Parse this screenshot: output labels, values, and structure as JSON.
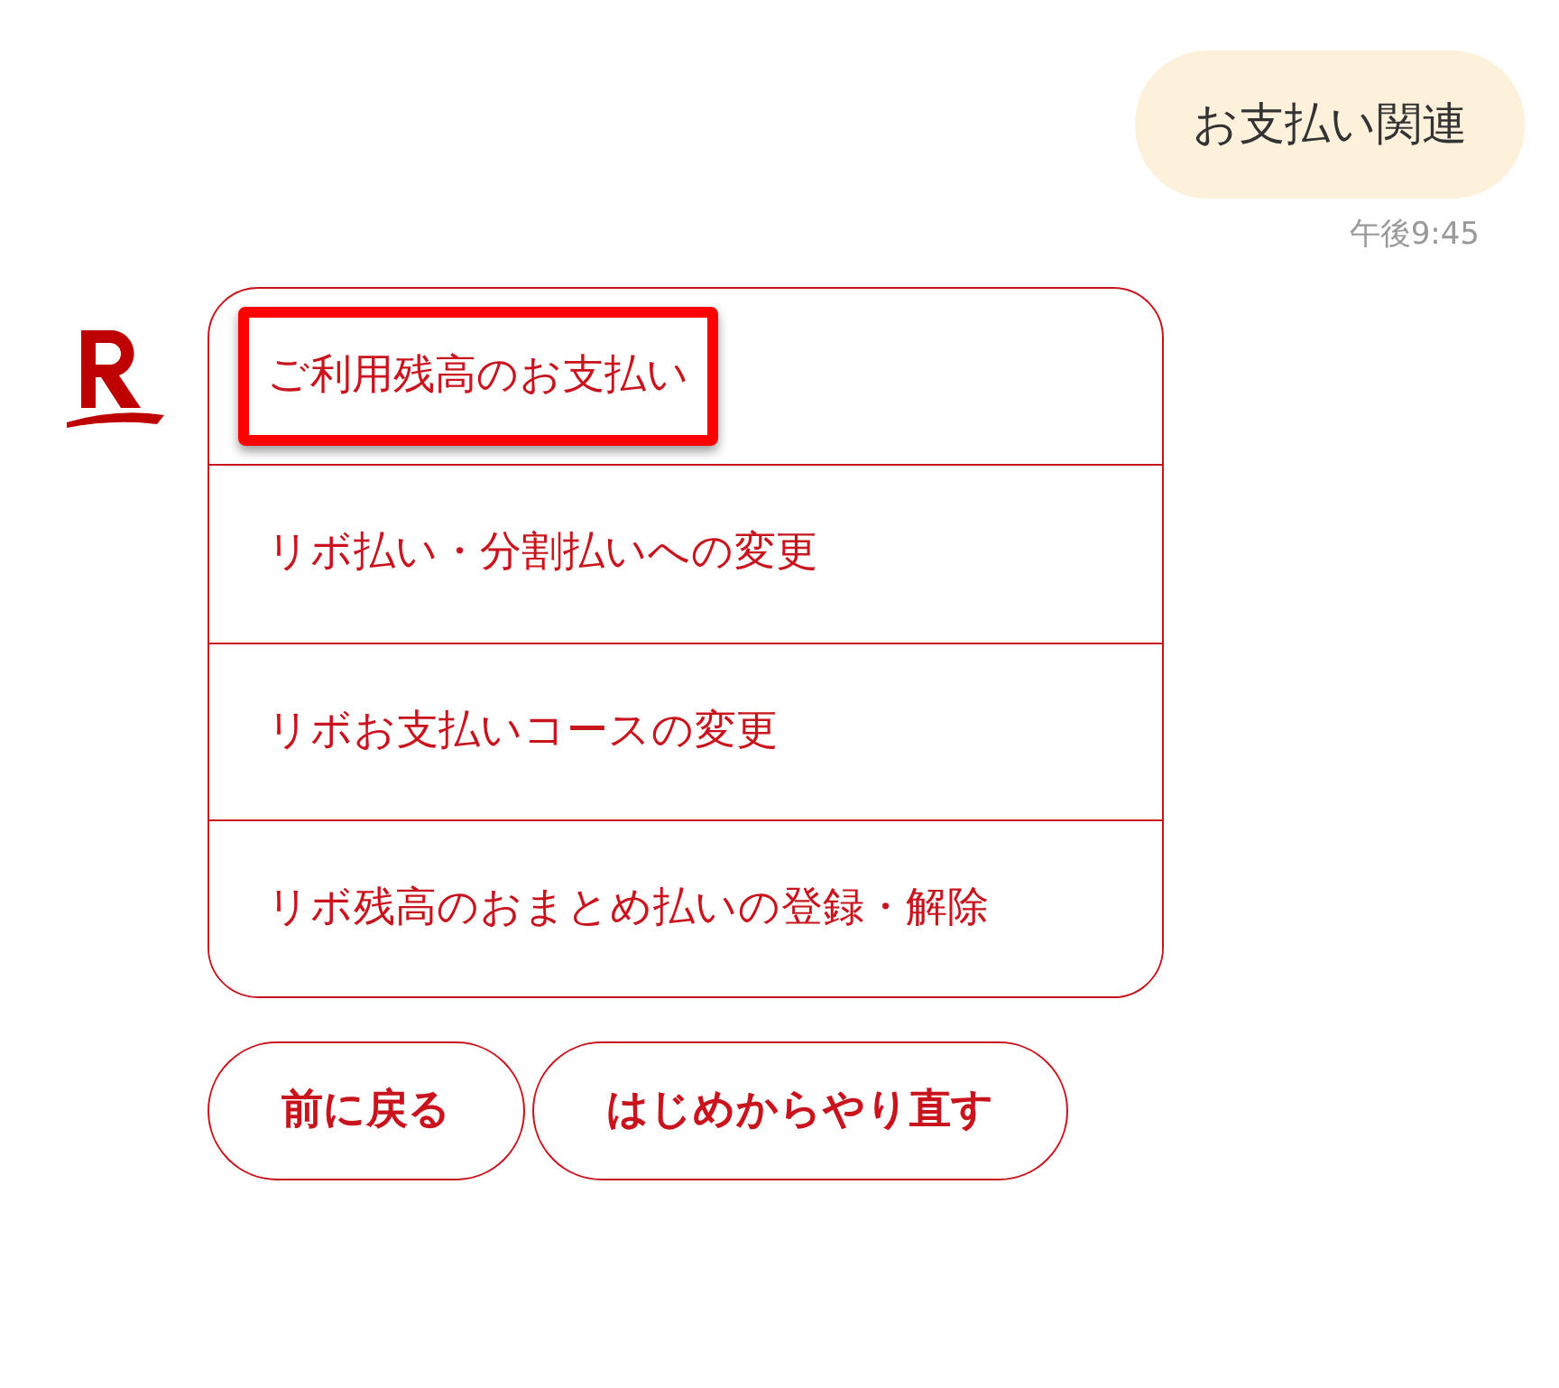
{
  "user_message": {
    "text": "お支払い関連",
    "time": "午後9:45"
  },
  "bot": {
    "options": [
      {
        "label": "ご利用残高のお支払い",
        "highlighted": true
      },
      {
        "label": "リボ払い・分割払いへの変更",
        "highlighted": false
      },
      {
        "label": "リボお支払いコースの変更",
        "highlighted": false
      },
      {
        "label": "リボ残高のおまとめ払いの登録・解除",
        "highlighted": false
      }
    ]
  },
  "buttons": [
    {
      "label": "前に戻る"
    },
    {
      "label": "はじめからやり直す"
    }
  ]
}
